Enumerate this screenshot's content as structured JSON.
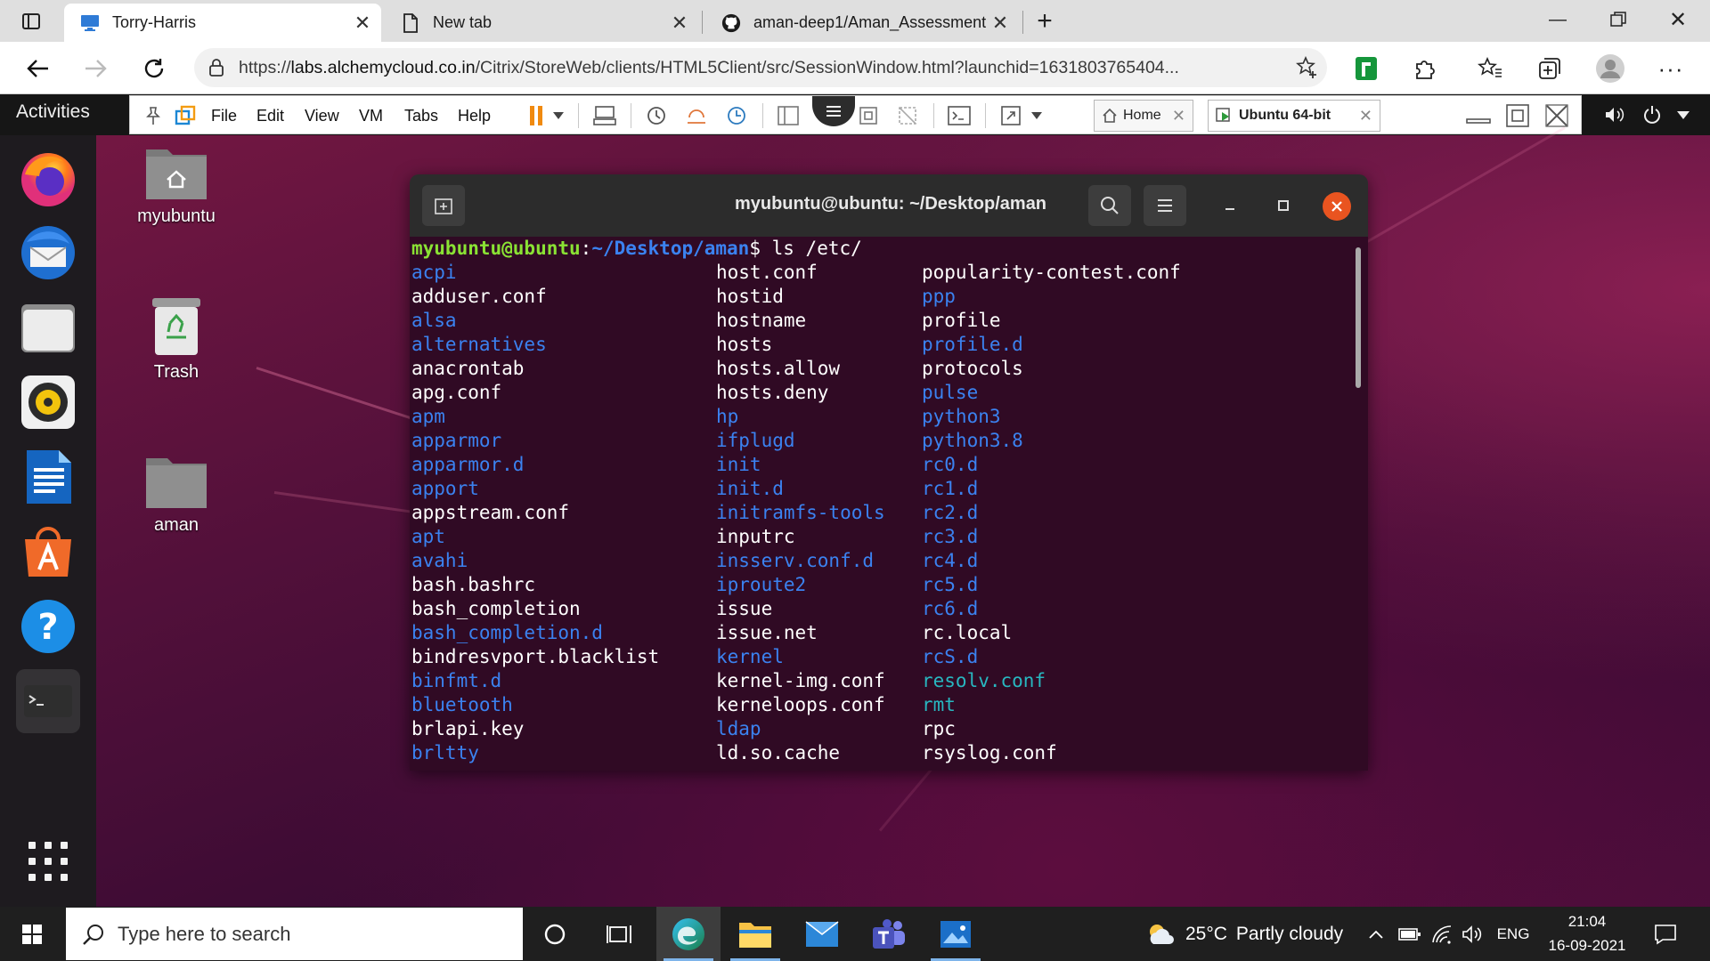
{
  "browser": {
    "tabs": [
      {
        "label": "Torry-Harris",
        "icon": "remote-desktop-icon"
      },
      {
        "label": "New tab",
        "icon": "page-icon"
      },
      {
        "label": "aman-deep1/Aman_Assessment",
        "icon": "github-icon"
      }
    ],
    "url_prefix": "https://",
    "url_domain": "labs.alchemycloud.co.in",
    "url_path": "/Citrix/StoreWeb/clients/HTML5Client/src/SessionWindow.html?launchid=1631803765404..."
  },
  "gnome": {
    "activities": "Activities"
  },
  "vmware": {
    "menus": [
      "File",
      "Edit",
      "View",
      "VM",
      "Tabs",
      "Help"
    ],
    "tabs": [
      {
        "label": "Home"
      },
      {
        "label": "Ubuntu 64-bit"
      }
    ]
  },
  "desktop_icons": [
    {
      "label": "myubuntu"
    },
    {
      "label": "Trash"
    },
    {
      "label": "aman"
    }
  ],
  "terminal": {
    "title": "myubuntu@ubuntu: ~/Desktop/aman",
    "prompt_user": "myubuntu@ubuntu",
    "prompt_sep": ":",
    "prompt_path": "~/Desktop/aman",
    "prompt_end": "$ ",
    "command": "ls /etc/",
    "columns": [
      [
        {
          "name": "acpi",
          "kind": "dir"
        },
        {
          "name": "adduser.conf",
          "kind": "file"
        },
        {
          "name": "alsa",
          "kind": "dir"
        },
        {
          "name": "alternatives",
          "kind": "dir"
        },
        {
          "name": "anacrontab",
          "kind": "file"
        },
        {
          "name": "apg.conf",
          "kind": "file"
        },
        {
          "name": "apm",
          "kind": "dir"
        },
        {
          "name": "apparmor",
          "kind": "dir"
        },
        {
          "name": "apparmor.d",
          "kind": "dir"
        },
        {
          "name": "apport",
          "kind": "dir"
        },
        {
          "name": "appstream.conf",
          "kind": "file"
        },
        {
          "name": "apt",
          "kind": "dir"
        },
        {
          "name": "avahi",
          "kind": "dir"
        },
        {
          "name": "bash.bashrc",
          "kind": "file"
        },
        {
          "name": "bash_completion",
          "kind": "file"
        },
        {
          "name": "bash_completion.d",
          "kind": "dir"
        },
        {
          "name": "bindresvport.blacklist",
          "kind": "file"
        },
        {
          "name": "binfmt.d",
          "kind": "dir"
        },
        {
          "name": "bluetooth",
          "kind": "dir"
        },
        {
          "name": "brlapi.key",
          "kind": "file"
        },
        {
          "name": "brltty",
          "kind": "dir"
        }
      ],
      [
        {
          "name": "host.conf",
          "kind": "file"
        },
        {
          "name": "hostid",
          "kind": "file"
        },
        {
          "name": "hostname",
          "kind": "file"
        },
        {
          "name": "hosts",
          "kind": "file"
        },
        {
          "name": "hosts.allow",
          "kind": "file"
        },
        {
          "name": "hosts.deny",
          "kind": "file"
        },
        {
          "name": "hp",
          "kind": "dir"
        },
        {
          "name": "ifplugd",
          "kind": "dir"
        },
        {
          "name": "init",
          "kind": "dir"
        },
        {
          "name": "init.d",
          "kind": "dir"
        },
        {
          "name": "initramfs-tools",
          "kind": "dir"
        },
        {
          "name": "inputrc",
          "kind": "file"
        },
        {
          "name": "insserv.conf.d",
          "kind": "dir"
        },
        {
          "name": "iproute2",
          "kind": "dir"
        },
        {
          "name": "issue",
          "kind": "file"
        },
        {
          "name": "issue.net",
          "kind": "file"
        },
        {
          "name": "kernel",
          "kind": "dir"
        },
        {
          "name": "kernel-img.conf",
          "kind": "file"
        },
        {
          "name": "kerneloops.conf",
          "kind": "file"
        },
        {
          "name": "ldap",
          "kind": "dir"
        },
        {
          "name": "ld.so.cache",
          "kind": "file"
        }
      ],
      [
        {
          "name": "popularity-contest.conf",
          "kind": "file"
        },
        {
          "name": "ppp",
          "kind": "dir"
        },
        {
          "name": "profile",
          "kind": "file"
        },
        {
          "name": "profile.d",
          "kind": "dir"
        },
        {
          "name": "protocols",
          "kind": "file"
        },
        {
          "name": "pulse",
          "kind": "dir"
        },
        {
          "name": "python3",
          "kind": "dir"
        },
        {
          "name": "python3.8",
          "kind": "dir"
        },
        {
          "name": "rc0.d",
          "kind": "dir"
        },
        {
          "name": "rc1.d",
          "kind": "dir"
        },
        {
          "name": "rc2.d",
          "kind": "dir"
        },
        {
          "name": "rc3.d",
          "kind": "dir"
        },
        {
          "name": "rc4.d",
          "kind": "dir"
        },
        {
          "name": "rc5.d",
          "kind": "dir"
        },
        {
          "name": "rc6.d",
          "kind": "dir"
        },
        {
          "name": "rc.local",
          "kind": "file"
        },
        {
          "name": "rcS.d",
          "kind": "dir"
        },
        {
          "name": "resolv.conf",
          "kind": "link"
        },
        {
          "name": "rmt",
          "kind": "link"
        },
        {
          "name": "rpc",
          "kind": "file"
        },
        {
          "name": "rsyslog.conf",
          "kind": "file"
        }
      ]
    ],
    "colors": {
      "prompt_user": "#8ae234",
      "prompt_path": "#3b82f0",
      "dir": "#3b82f0",
      "link": "#28b7c0",
      "file": "#ffffff",
      "background": "#300a24"
    }
  },
  "taskbar": {
    "search_placeholder": "Type here to search",
    "weather_temp": "25°C",
    "weather_desc": "Partly cloudy",
    "language": "ENG",
    "time": "21:04",
    "date": "16-09-2021"
  }
}
